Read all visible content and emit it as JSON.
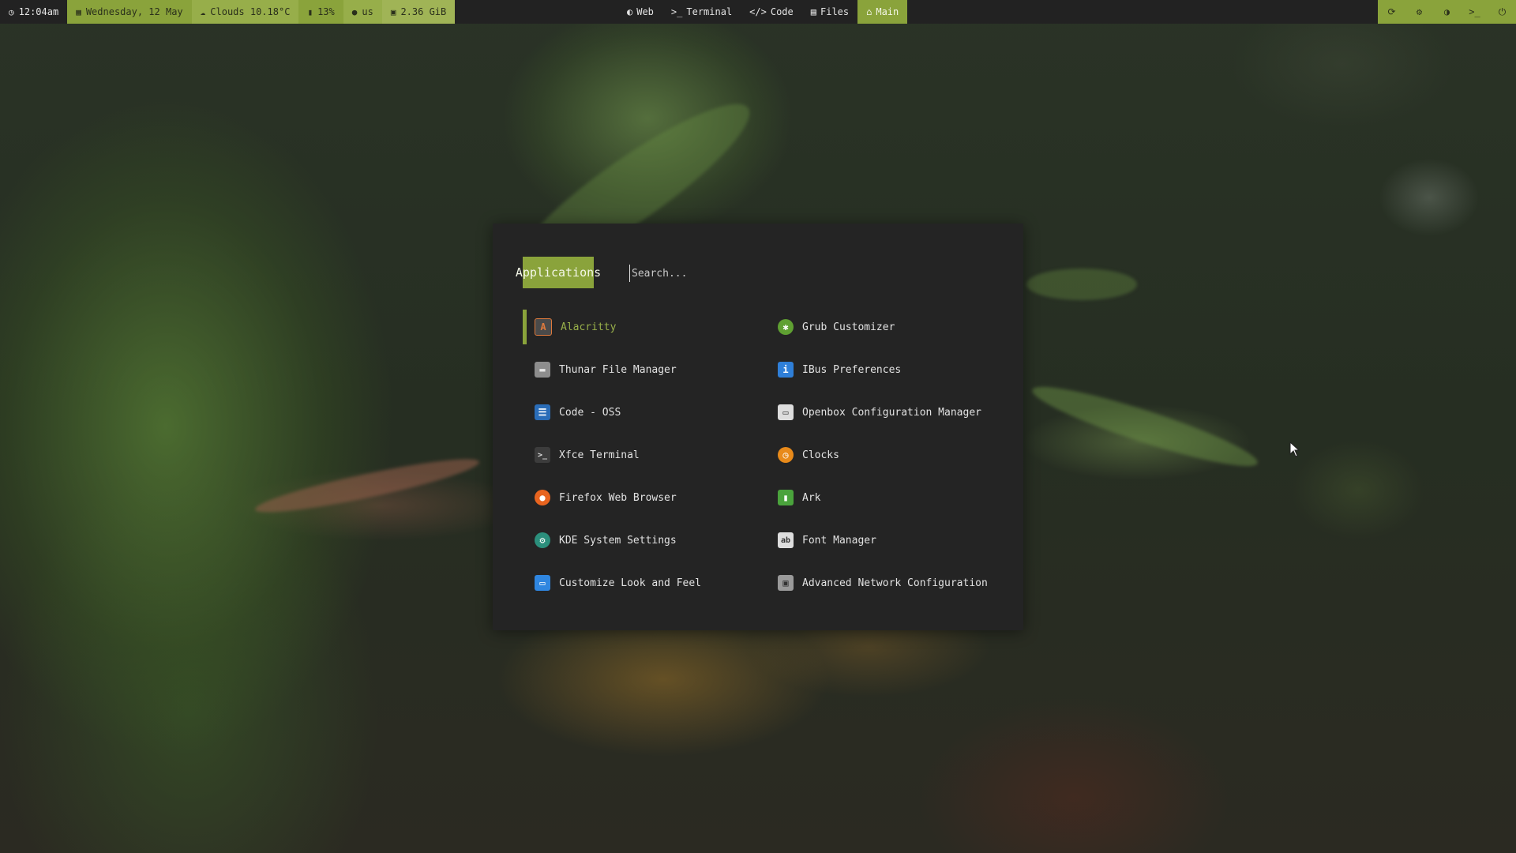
{
  "topbar": {
    "time": "12:04am",
    "date": "Wednesday, 12 May",
    "weather": "Clouds 10.18°C",
    "battery": "13%",
    "keyboard": "us",
    "memory": "2.36 GiB",
    "workspaces": [
      {
        "label": "Web",
        "icon": "globe-icon"
      },
      {
        "label": "Terminal",
        "icon": "terminal-icon"
      },
      {
        "label": "Code",
        "icon": "code-icon"
      },
      {
        "label": "Files",
        "icon": "file-icon"
      },
      {
        "label": "Main",
        "icon": "home-icon",
        "active": true
      }
    ],
    "controls": [
      "refresh-icon",
      "gear-icon",
      "moon-icon",
      "terminal-prompt-icon",
      "power-icon"
    ]
  },
  "launcher": {
    "mode_label": "Applications",
    "search_placeholder": "Search...",
    "apps": [
      {
        "name": "Alacritty",
        "icon": "alacritty-icon",
        "color": "#4a4a4a",
        "selected": true
      },
      {
        "name": "Grub Customizer",
        "icon": "grub-customizer-icon",
        "color": "#5fa032"
      },
      {
        "name": "Thunar File Manager",
        "icon": "thunar-icon",
        "color": "#8d8d8d"
      },
      {
        "name": "IBus Preferences",
        "icon": "ibus-icon",
        "color": "#2f7fd8"
      },
      {
        "name": "Code - OSS",
        "icon": "code-oss-icon",
        "color": "#2a6db8"
      },
      {
        "name": "Openbox Configuration Manager",
        "icon": "openbox-icon",
        "color": "#dddddd"
      },
      {
        "name": "Xfce Terminal",
        "icon": "xfce-terminal-icon",
        "color": "#3c3c3c"
      },
      {
        "name": "Clocks",
        "icon": "clock-icon",
        "color": "#e88a1a"
      },
      {
        "name": "Firefox Web Browser",
        "icon": "firefox-icon",
        "color": "#e8641f"
      },
      {
        "name": "Ark",
        "icon": "ark-icon",
        "color": "#4aa33c"
      },
      {
        "name": "KDE System Settings",
        "icon": "kde-settings-icon",
        "color": "#2b8f7c"
      },
      {
        "name": "Font Manager",
        "icon": "font-manager-icon",
        "color": "#dedede"
      },
      {
        "name": "Customize Look and Feel",
        "icon": "look-and-feel-icon",
        "color": "#2f86e0"
      },
      {
        "name": "Advanced Network Configuration",
        "icon": "network-icon",
        "color": "#9a9a9a"
      }
    ]
  },
  "colors": {
    "accent": "#8aa33b",
    "panel": "#242424",
    "bar": "#222222"
  }
}
